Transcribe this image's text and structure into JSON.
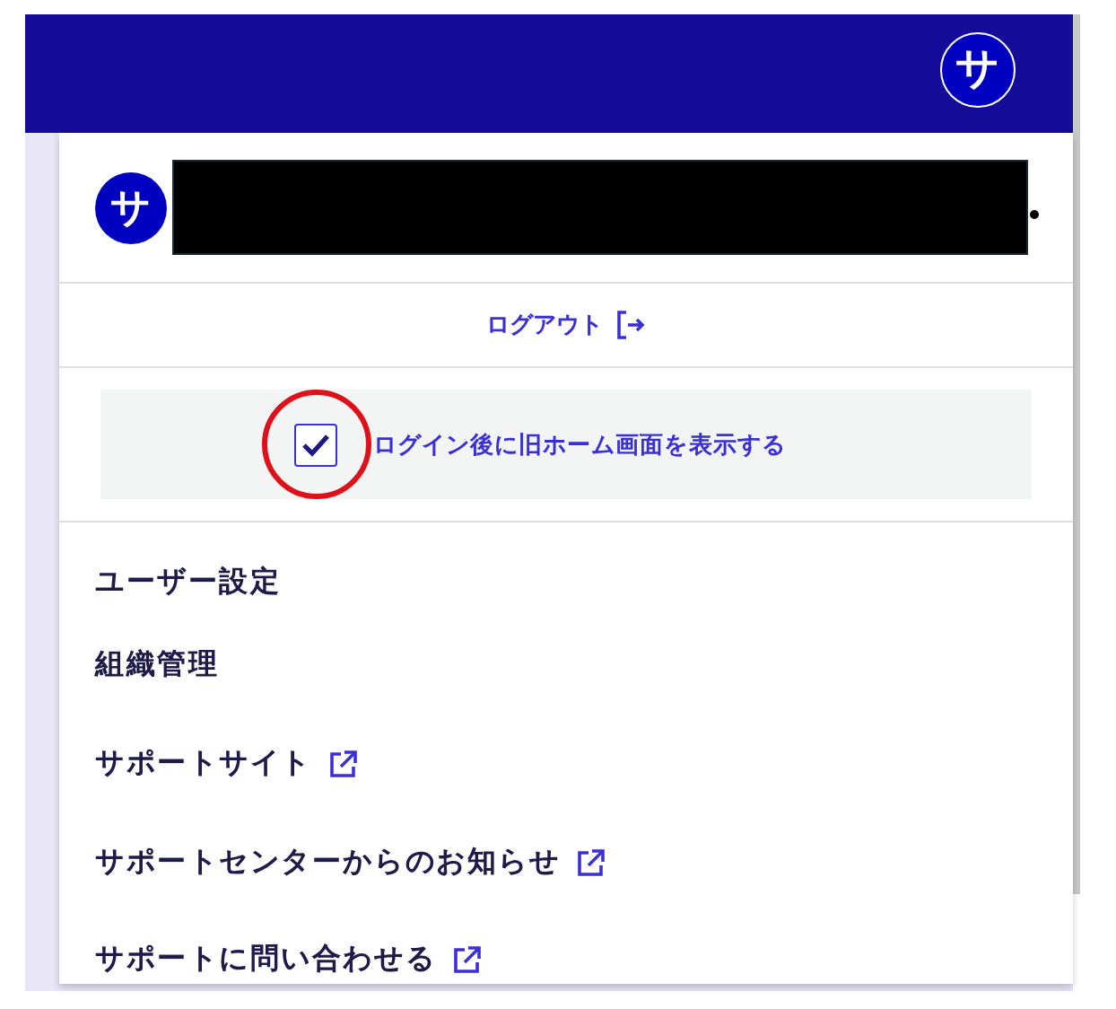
{
  "header": {
    "avatar": "サ"
  },
  "account": {
    "avatar": "サ",
    "name_redacted": true
  },
  "logout": {
    "label": "ログアウト"
  },
  "option": {
    "label": "ログイン後に旧ホーム画面を表示する",
    "checked": true,
    "circled": true
  },
  "menu_items": [
    {
      "label": "ユーザー設定",
      "external": false
    },
    {
      "label": "組織管理",
      "external": false
    },
    {
      "label": "サポートサイト",
      "external": true
    },
    {
      "label": "サポートセンターからのお知らせ",
      "external": true
    },
    {
      "label": "サポートに問い合わせる",
      "external": true
    }
  ]
}
